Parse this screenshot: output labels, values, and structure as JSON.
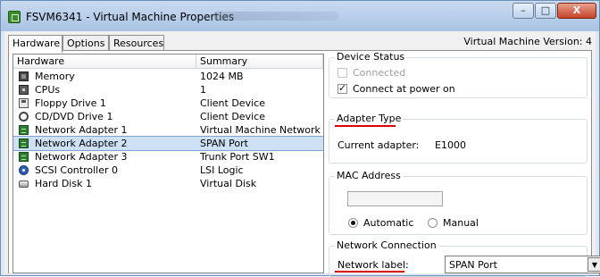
{
  "window": {
    "title": "FSVM6341 - Virtual Machine Properties",
    "controls": {
      "minimize": "–",
      "maximize": "□",
      "close": "X"
    }
  },
  "tabs": [
    "Hardware",
    "Options",
    "Resources"
  ],
  "version_label": "Virtual Machine Version: 4",
  "hardware_list": {
    "columns": [
      "Hardware",
      "Summary"
    ],
    "rows": [
      {
        "icon": "memory-icon",
        "name": "Memory",
        "summary": "1024 MB"
      },
      {
        "icon": "cpu-icon",
        "name": "CPUs",
        "summary": "1"
      },
      {
        "icon": "floppy-icon",
        "name": "Floppy Drive 1",
        "summary": "Client Device"
      },
      {
        "icon": "cd-dvd-icon",
        "name": "CD/DVD Drive 1",
        "summary": "Client Device"
      },
      {
        "icon": "network-adapter-icon",
        "name": "Network Adapter 1",
        "summary": "Virtual Machine Network"
      },
      {
        "icon": "network-adapter-icon",
        "name": "Network Adapter 2",
        "summary": "SPAN Port",
        "selected": true
      },
      {
        "icon": "network-adapter-icon",
        "name": "Network Adapter 3",
        "summary": "Trunk Port SW1"
      },
      {
        "icon": "scsi-controller-icon",
        "name": "SCSI Controller 0",
        "summary": "LSI Logic"
      },
      {
        "icon": "hard-disk-icon",
        "name": "Hard Disk 1",
        "summary": "Virtual Disk"
      }
    ]
  },
  "device_status": {
    "legend": "Device Status",
    "connected_label": "Connected",
    "connected_checked": false,
    "connected_enabled": false,
    "connect_power_label": "Connect at power on",
    "connect_power_checked": true
  },
  "adapter_type": {
    "legend": "Adapter Type",
    "current_label": "Current adapter:",
    "current_value": "E1000"
  },
  "mac_address": {
    "legend": "MAC Address",
    "value": "",
    "automatic_label": "Automatic",
    "manual_label": "Manual",
    "selected": "Automatic"
  },
  "network_connection": {
    "legend": "Network Connection",
    "label": "Network label:",
    "value": "SPAN Port"
  },
  "colors": {
    "selection": "#cde0f4",
    "annotation_red": "#dd0000"
  }
}
